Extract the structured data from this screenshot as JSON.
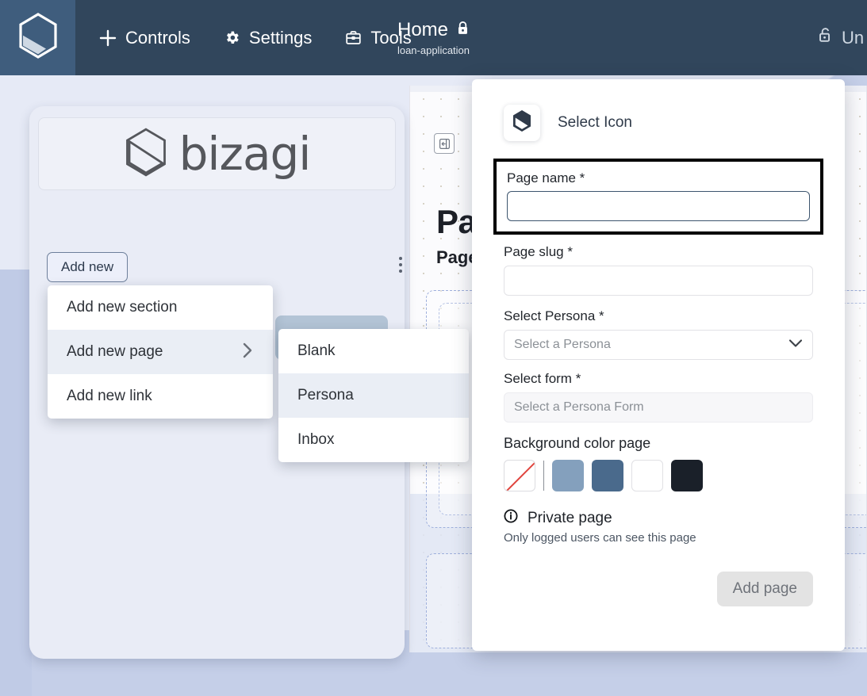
{
  "colors": {
    "topbar_bg": "#31465c",
    "logo_block_bg": "#3f5d7d",
    "canvas_bg": "#fbfbfd",
    "page_bg": "#c5cfe8",
    "panel_bg": "#e9ecf6",
    "focus_outline": "#000000",
    "disabled_button_bg": "#e3e3e3"
  },
  "topbar": {
    "logo_icon": "bizagi-hexagon-icon",
    "nav": [
      {
        "icon": "plus-icon",
        "label": "Controls"
      },
      {
        "icon": "gear-icon",
        "label": "Settings"
      },
      {
        "icon": "toolbox-icon",
        "label": "Tools"
      }
    ],
    "title": "Home",
    "title_icon": "lock-closed-icon",
    "subtitle": "loan-application",
    "right": {
      "icon": "lock-open-icon",
      "label": "Un"
    }
  },
  "left_panel": {
    "logo_text": "bizagi",
    "logo_icon": "bizagi-hexagon-icon",
    "add_new_label": "Add new",
    "kebab_icon": "more-vertical-icon"
  },
  "menu_primary": {
    "items": [
      {
        "label": "Add new section",
        "has_submenu": false,
        "active": false
      },
      {
        "label": "Add new page",
        "has_submenu": true,
        "active": true
      },
      {
        "label": "Add new link",
        "has_submenu": false,
        "active": false
      }
    ],
    "submenu_chevron": "chevron-right-icon"
  },
  "menu_secondary": {
    "items": [
      {
        "label": "Blank",
        "active": false
      },
      {
        "label": "Persona",
        "active": true
      },
      {
        "label": "Inbox",
        "active": false
      }
    ]
  },
  "canvas": {
    "collapse_icon": "collapse-panel-icon",
    "title": "Pa",
    "subtitle": "Page"
  },
  "dialog": {
    "icon_button": {
      "icon": "bizagi-hexagon-icon",
      "label": "Select Icon"
    },
    "page_name": {
      "label": "Page name *",
      "value": "",
      "placeholder": "",
      "focused": true
    },
    "page_slug": {
      "label": "Page slug *",
      "value": "",
      "placeholder": ""
    },
    "select_persona": {
      "label": "Select Persona *",
      "value": "",
      "placeholder": "Select a Persona",
      "chevron_icon": "chevron-down-icon"
    },
    "select_form": {
      "label": "Select form *",
      "value": "",
      "placeholder": "Select a Persona Form",
      "disabled": true
    },
    "background_color": {
      "label": "Background color page",
      "swatches": [
        {
          "name": "none",
          "color": "transparent"
        },
        {
          "name": "light-blue",
          "color": "#84a0bd"
        },
        {
          "name": "slate-blue",
          "color": "#4a6a8c"
        },
        {
          "name": "white",
          "color": "#ffffff"
        },
        {
          "name": "near-black",
          "color": "#1a2029"
        }
      ]
    },
    "private": {
      "icon": "info-icon",
      "label": "Private page",
      "description": "Only logged users can see this page"
    },
    "submit": {
      "label": "Add page",
      "enabled": false
    }
  }
}
